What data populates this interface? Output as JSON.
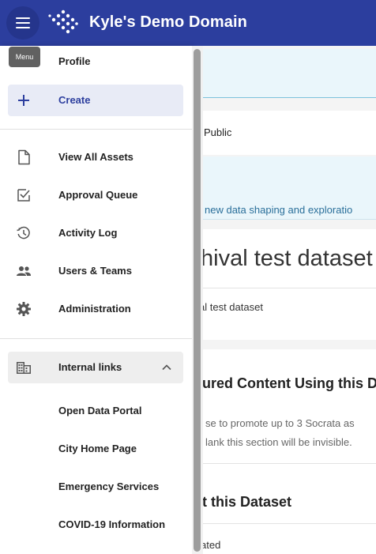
{
  "header": {
    "title": "Kyle's Demo Domain",
    "menu_tooltip": "Menu"
  },
  "drawer": {
    "items": [
      {
        "label": "Profile",
        "icon": "person-icon"
      },
      {
        "label": "Create",
        "icon": "plus-icon"
      },
      {
        "label": "View All Assets",
        "icon": "document-icon"
      },
      {
        "label": "Approval Queue",
        "icon": "checkbox-icon"
      },
      {
        "label": "Activity Log",
        "icon": "history-icon"
      },
      {
        "label": "Users & Teams",
        "icon": "people-icon"
      },
      {
        "label": "Administration",
        "icon": "gear-icon"
      }
    ],
    "group": {
      "label": "Internal links",
      "icon": "building-icon",
      "links": [
        "Open Data Portal",
        "City Home Page",
        "Emergency Services",
        "COVID-19 Information"
      ]
    }
  },
  "background": {
    "visibility": ") Public",
    "notice": "new data shaping and exploratio",
    "dataset_title": "hival test dataset",
    "dataset_desc": "al test dataset",
    "featured_heading": "ured Content Using this Da",
    "featured_help_1": "se to promote up to 3 Socrata as",
    "featured_help_2": "lank this section will be invisible.",
    "about_heading": "t this Dataset",
    "updated_label": "ated"
  },
  "colors": {
    "header": "#2c3e9e",
    "active_bg": "#e8ebf6",
    "accent": "#2c3e9e"
  }
}
